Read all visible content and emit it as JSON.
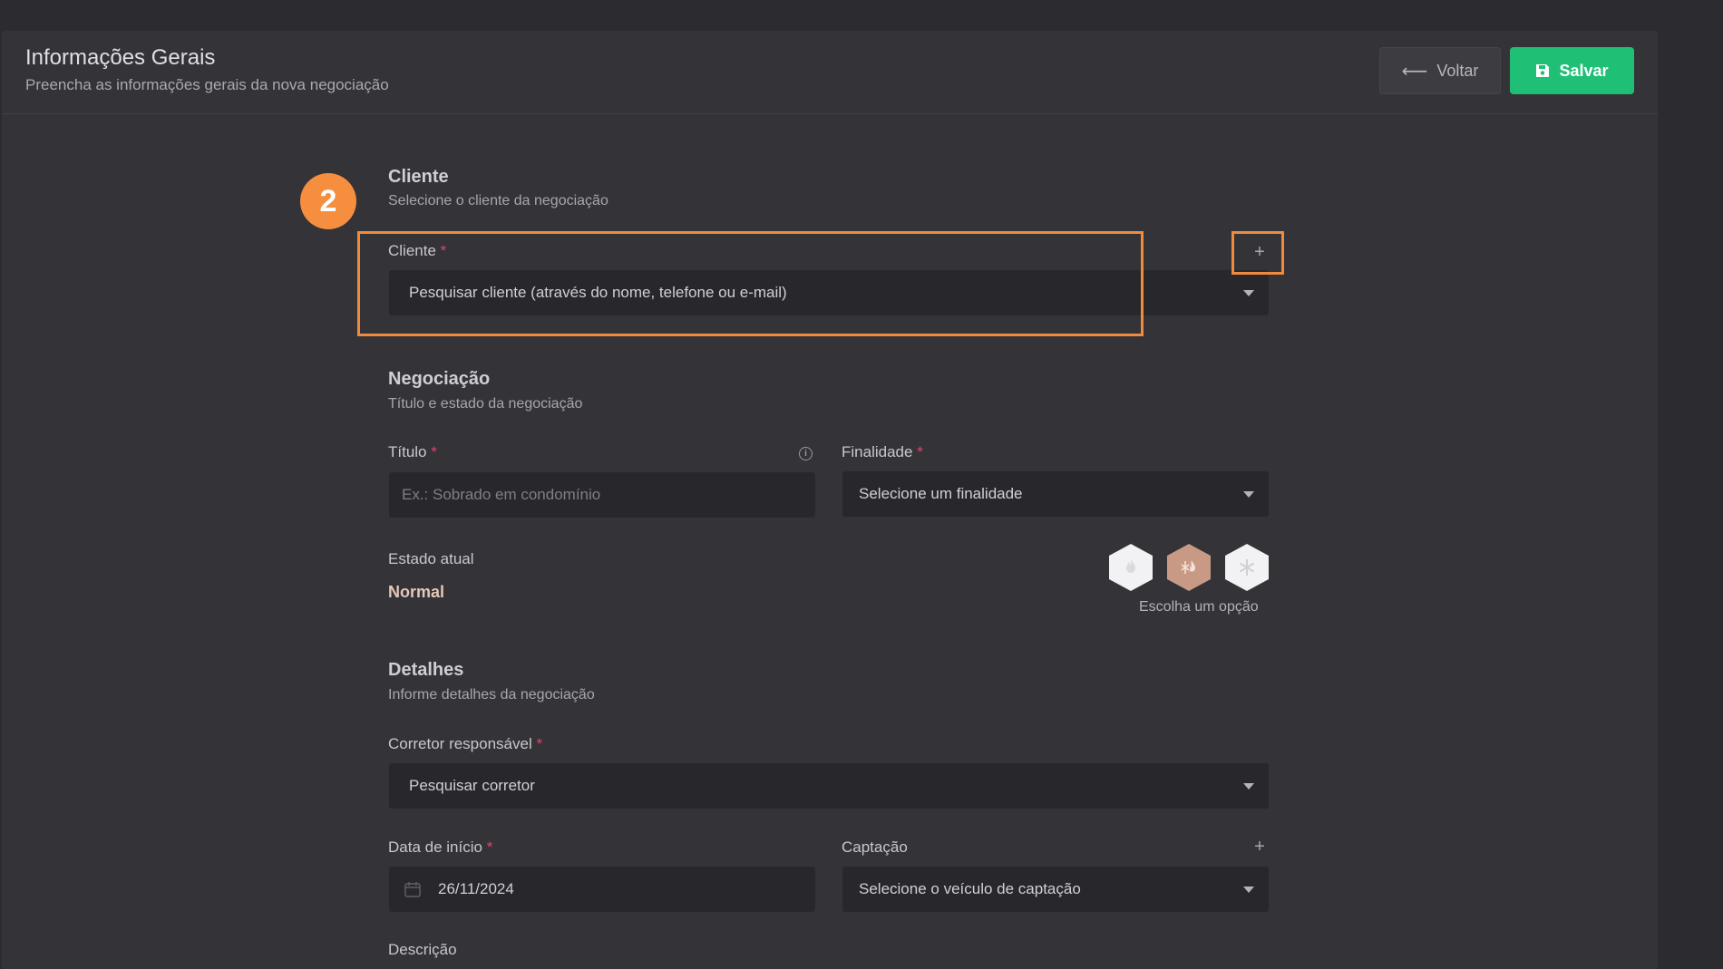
{
  "header": {
    "title": "Informações Gerais",
    "subtitle": "Preencha as informações gerais da nova negociação",
    "back_label": "Voltar",
    "save_label": "Salvar"
  },
  "step_badge": "2",
  "cliente_section": {
    "title": "Cliente",
    "subtitle": "Selecione o cliente da negociação",
    "field_label": "Cliente",
    "required_mark": "*",
    "field_value": "Pesquisar cliente (através do nome, telefone ou e-mail)"
  },
  "negociacao_section": {
    "title": "Negociação",
    "subtitle": "Título e estado da negociação",
    "titulo_label": "Título",
    "titulo_placeholder": "Ex.: Sobrado em condomínio",
    "finalidade_label": "Finalidade",
    "finalidade_value": "Selecione um finalidade",
    "estado_label": "Estado atual",
    "estado_value": "Normal",
    "estado_hint": "Escolha um opção",
    "estado_icons": [
      "fire-icon",
      "warm-cold-icon",
      "snowflake-icon"
    ]
  },
  "detalhes_section": {
    "title": "Detalhes",
    "subtitle": "Informe detalhes da negociação",
    "corretor_label": "Corretor responsável",
    "corretor_value": "Pesquisar corretor",
    "data_label": "Data de início",
    "data_value": "26/11/2024",
    "captacao_label": "Captação",
    "captacao_value": "Selecione o veículo de captação",
    "descricao_label": "Descrição"
  },
  "colors": {
    "accent_green": "#1fbf76",
    "highlight_orange": "#f08a3c",
    "required_red": "#e0446a",
    "background": "#333338"
  }
}
